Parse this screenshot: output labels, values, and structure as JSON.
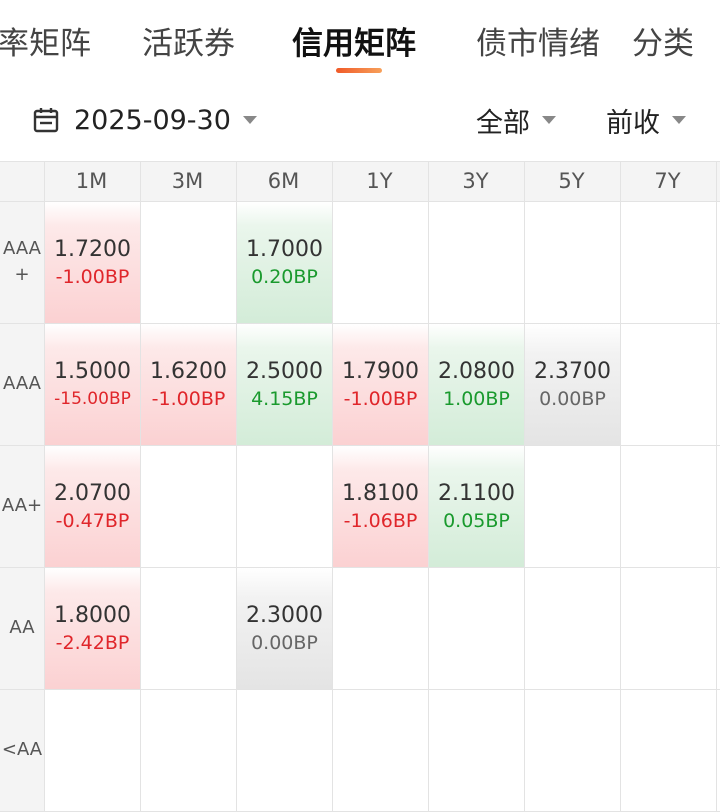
{
  "tabs": [
    {
      "label": "率矩阵"
    },
    {
      "label": "活跃券"
    },
    {
      "label": "信用矩阵"
    },
    {
      "label": "债市情绪"
    },
    {
      "label": "分类"
    }
  ],
  "filters": {
    "date": "2025-09-30",
    "scope": "全部",
    "basis": "前收"
  },
  "matrix": {
    "columns": [
      "1M",
      "3M",
      "6M",
      "1Y",
      "3Y",
      "5Y",
      "7Y"
    ],
    "rows": [
      {
        "label": "AAA\n+",
        "cells": [
          {
            "value": "1.7200",
            "change": "-1.00BP",
            "trend": "down"
          },
          null,
          {
            "value": "1.7000",
            "change": "0.20BP",
            "trend": "up"
          },
          null,
          null,
          null,
          null
        ]
      },
      {
        "label": "AAA",
        "cells": [
          {
            "value": "1.5000",
            "change": "-15.00BP",
            "trend": "down"
          },
          {
            "value": "1.6200",
            "change": "-1.00BP",
            "trend": "down"
          },
          {
            "value": "2.5000",
            "change": "4.15BP",
            "trend": "up"
          },
          {
            "value": "1.7900",
            "change": "-1.00BP",
            "trend": "down"
          },
          {
            "value": "2.0800",
            "change": "1.00BP",
            "trend": "up"
          },
          {
            "value": "2.3700",
            "change": "0.00BP",
            "trend": "flat"
          },
          null
        ]
      },
      {
        "label": "AA+",
        "cells": [
          {
            "value": "2.0700",
            "change": "-0.47BP",
            "trend": "down"
          },
          null,
          null,
          {
            "value": "1.8100",
            "change": "-1.06BP",
            "trend": "down"
          },
          {
            "value": "2.1100",
            "change": "0.05BP",
            "trend": "up"
          },
          null,
          null
        ]
      },
      {
        "label": "AA",
        "cells": [
          {
            "value": "1.8000",
            "change": "-2.42BP",
            "trend": "down"
          },
          null,
          {
            "value": "2.3000",
            "change": "0.00BP",
            "trend": "flat"
          },
          null,
          null,
          null,
          null
        ]
      },
      {
        "label": "<AA",
        "cells": [
          null,
          null,
          null,
          null,
          null,
          null,
          null
        ]
      }
    ]
  },
  "colors": {
    "accent": "#f05a28",
    "up": "#1a9a2e",
    "down": "#e0262b",
    "flat": "#666666"
  },
  "icons": {
    "calendar": "calendar-icon",
    "dropdown": "caret-down-icon"
  }
}
